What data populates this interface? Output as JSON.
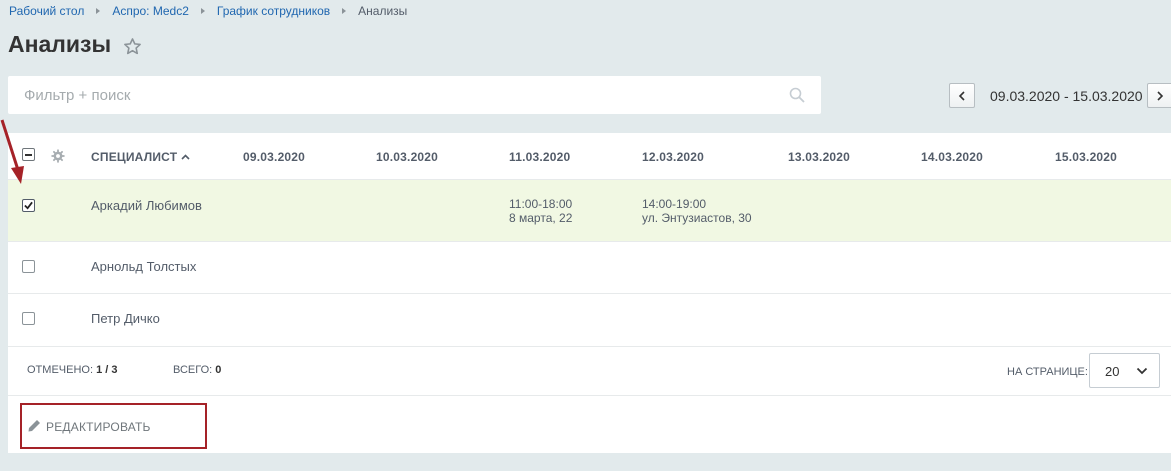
{
  "breadcrumbs": [
    "Рабочий стол",
    "Аспро: Medc2",
    "График сотрудников",
    "Анализы"
  ],
  "page": {
    "title": "Анализы"
  },
  "filter": {
    "placeholder": "Фильтр + поиск",
    "value": ""
  },
  "date_nav": {
    "range": "09.03.2020 - 15.03.2020"
  },
  "grid": {
    "columns": [
      "СПЕЦИАЛИСТ",
      "09.03.2020",
      "10.03.2020",
      "11.03.2020",
      "12.03.2020",
      "13.03.2020",
      "14.03.2020",
      "15.03.2020"
    ],
    "sort": "ascending",
    "rows": [
      {
        "name": "Аркадий Любимов",
        "checked": true,
        "slots": [
          {
            "date": "11.03.2020",
            "time": "11:00-18:00",
            "place": "8 марта, 22"
          },
          {
            "date": "12.03.2020",
            "time": "14:00-19:00",
            "place": "ул. Энтузиастов, 30"
          }
        ]
      },
      {
        "name": "Арнольд Толстых",
        "checked": false,
        "slots": []
      },
      {
        "name": "Петр Дичко",
        "checked": false,
        "slots": []
      }
    ]
  },
  "footer": {
    "selected_label": "ОТМЕЧЕНО:",
    "selected_value": "1 / 3",
    "total_label": "ВСЕГО:",
    "total_value": "0",
    "per_page_label": "НА СТРАНИЦЕ:",
    "per_page_value": "20"
  },
  "actions": {
    "edit_label": "РЕДАКТИРОВАТЬ"
  },
  "colors": {
    "background": "#e2eaec",
    "link": "#2067b0",
    "selected_row": "#f1f8e3",
    "annotation": "#a52228"
  }
}
